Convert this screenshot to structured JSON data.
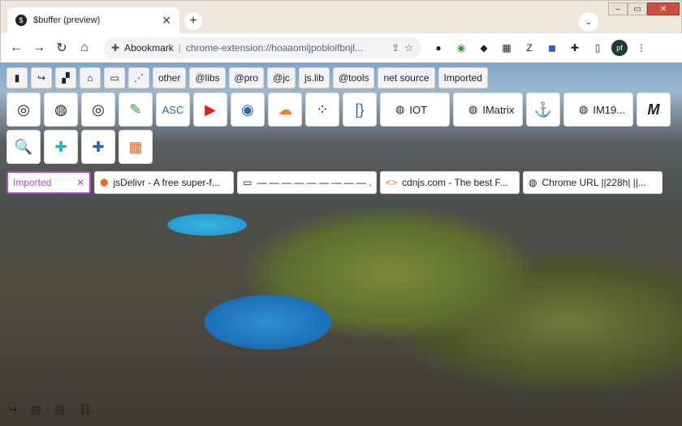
{
  "window": {
    "controls": {
      "minimize": "–",
      "restore": "▭",
      "close": "✕"
    }
  },
  "tab": {
    "favicon": "$",
    "title": "$buffer (preview)",
    "close": "✕",
    "new_tab": "+",
    "tab_menu": "⌄"
  },
  "toolbar": {
    "back": "←",
    "forward": "→",
    "reload": "↻",
    "home": "⌂",
    "site_name": "Abookmark",
    "url": "chrome-extension://hoaaomljpobloifbnjl...",
    "share": "⇪",
    "bookmark": "☆",
    "extensions": [
      "●",
      "◉",
      "◆",
      "▦",
      "Z",
      "◼",
      "✚",
      "▯"
    ],
    "avatar": "pf",
    "menu": "⋮"
  },
  "bookmark_bar": {
    "icon_chips": [
      "▮",
      "↪",
      "▞",
      "⌂",
      "▭",
      "⋰"
    ],
    "text_chips": [
      "other",
      "@libs",
      "@pro",
      "@jc",
      "js.lib",
      "@tools",
      "net  source",
      "Imported"
    ]
  },
  "grid": {
    "row1": [
      {
        "icon": "◎",
        "label": ""
      },
      {
        "icon": "◍",
        "label": ""
      },
      {
        "icon": "◎",
        "label": ""
      },
      {
        "icon": "✎",
        "label": ""
      },
      {
        "icon": "ASC",
        "label": ""
      },
      {
        "icon": "▶",
        "label": ""
      },
      {
        "icon": "◉",
        "label": ""
      },
      {
        "icon": "☁",
        "label": ""
      },
      {
        "icon": "⁘",
        "label": ""
      },
      {
        "icon": "[}",
        "label": ""
      },
      {
        "icon": "◍",
        "label": "IOT"
      },
      {
        "icon": "◍",
        "label": "IMatrix"
      },
      {
        "icon": "⚓",
        "label": ""
      },
      {
        "icon": "◍",
        "label": "IM19..."
      },
      {
        "icon": "M",
        "label": ""
      }
    ],
    "row2": [
      {
        "icon": "🔍",
        "label": ""
      },
      {
        "icon": "✚",
        "label": ""
      },
      {
        "icon": "✚",
        "label": ""
      },
      {
        "icon": "▦",
        "label": ""
      }
    ]
  },
  "tabs_row": [
    {
      "icon": "",
      "title": "Imported",
      "close": "✕"
    },
    {
      "icon": "⬢",
      "title": "jsDelivr - A free super-f..."
    },
    {
      "icon": "▭",
      "title": "— — — — — — — — — ..."
    },
    {
      "icon": "<>",
      "title": "cdnjs.com - The best F..."
    },
    {
      "icon": "◍",
      "title": "Chrome URL ||228h| ||..."
    }
  ],
  "bottom_icons": [
    "↪",
    "▤",
    "▤",
    "⛓"
  ]
}
